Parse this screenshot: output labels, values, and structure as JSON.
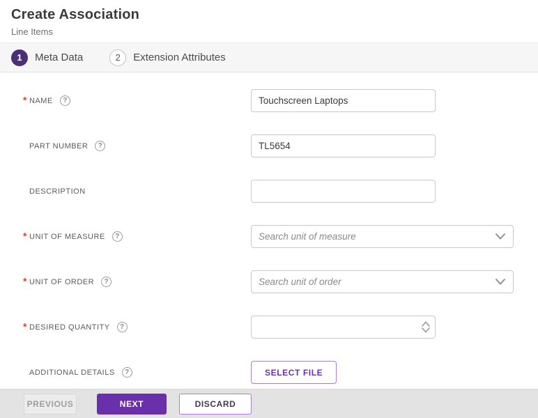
{
  "header": {
    "title": "Create Association",
    "subtitle": "Line Items"
  },
  "stepper": {
    "steps": [
      {
        "number": "1",
        "label": "Meta Data",
        "active": true
      },
      {
        "number": "2",
        "label": "Extension Attributes",
        "active": false
      }
    ]
  },
  "icons": {
    "help": "?",
    "required_marker": "*"
  },
  "form": {
    "fields": [
      {
        "label": "NAME",
        "required": true,
        "has_help": true,
        "type": "text",
        "value": "Touchscreen Laptops"
      },
      {
        "label": "PART NUMBER",
        "required": false,
        "has_help": true,
        "type": "text",
        "value": "TL5654"
      },
      {
        "label": "DESCRIPTION",
        "required": false,
        "has_help": false,
        "type": "text",
        "value": ""
      },
      {
        "label": "UNIT OF MEASURE",
        "required": true,
        "has_help": true,
        "type": "select",
        "placeholder": "Search unit of measure",
        "value": ""
      },
      {
        "label": "UNIT OF ORDER",
        "required": true,
        "has_help": true,
        "type": "select",
        "placeholder": "Search unit of order",
        "value": ""
      },
      {
        "label": "DESIRED QUANTITY",
        "required": true,
        "has_help": true,
        "type": "number",
        "value": ""
      },
      {
        "label": "ADDITIONAL DETAILS",
        "required": false,
        "has_help": true,
        "type": "file",
        "button_label": "SELECT FILE"
      }
    ]
  },
  "footer": {
    "previous_label": "PREVIOUS",
    "next_label": "NEXT",
    "discard_label": "DISCARD"
  },
  "colors": {
    "primary_purple": "#6a30ac",
    "step_active_purple": "#4b2e78",
    "purple_border": "#a87fd6",
    "required_red": "#e8402f",
    "stepper_bg": "#f6f6f6",
    "footer_bg": "#e3e3e3"
  }
}
